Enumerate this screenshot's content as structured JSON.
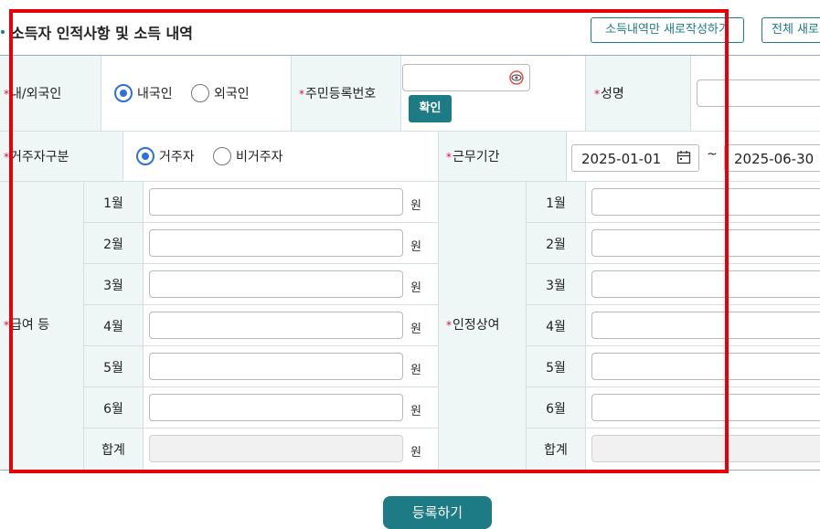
{
  "header": {
    "title": "소득자 인적사항 및 소득 내역",
    "btn_income_only": "소득내역만 새로작성하기",
    "btn_all_new": "전체 새로작성하기"
  },
  "row1": {
    "nationality_label": "내/외국인",
    "nationality_options": [
      "내국인",
      "외국인"
    ],
    "nationality_selected": "내국인",
    "rrn_label": "주민등록번호",
    "rrn_value": "",
    "confirm_button": "확인",
    "name_label": "성명",
    "name_value": ""
  },
  "row2": {
    "residency_label": "거주자구분",
    "residency_options": [
      "거주자",
      "비거주자"
    ],
    "residency_selected": "거주자",
    "period_label": "근무기간",
    "date_from": "2025-01-01",
    "separator": "~",
    "date_to": "2025-06-30"
  },
  "salary": {
    "label": "급여 등",
    "months": [
      "1월",
      "2월",
      "3월",
      "4월",
      "5월",
      "6월"
    ],
    "total_label": "합계",
    "unit": "원"
  },
  "bonus": {
    "label": "인정상여",
    "months": [
      "1월",
      "2월",
      "3월",
      "4월",
      "5월",
      "6월"
    ],
    "total_label": "합계"
  },
  "required_mark": "*",
  "footer": {
    "register_button": "등록하기"
  },
  "colors": {
    "accent": "#1d7b86",
    "required": "#e0123c",
    "highlight_box": "#e6000a",
    "label_bg": "#eef6f6"
  }
}
